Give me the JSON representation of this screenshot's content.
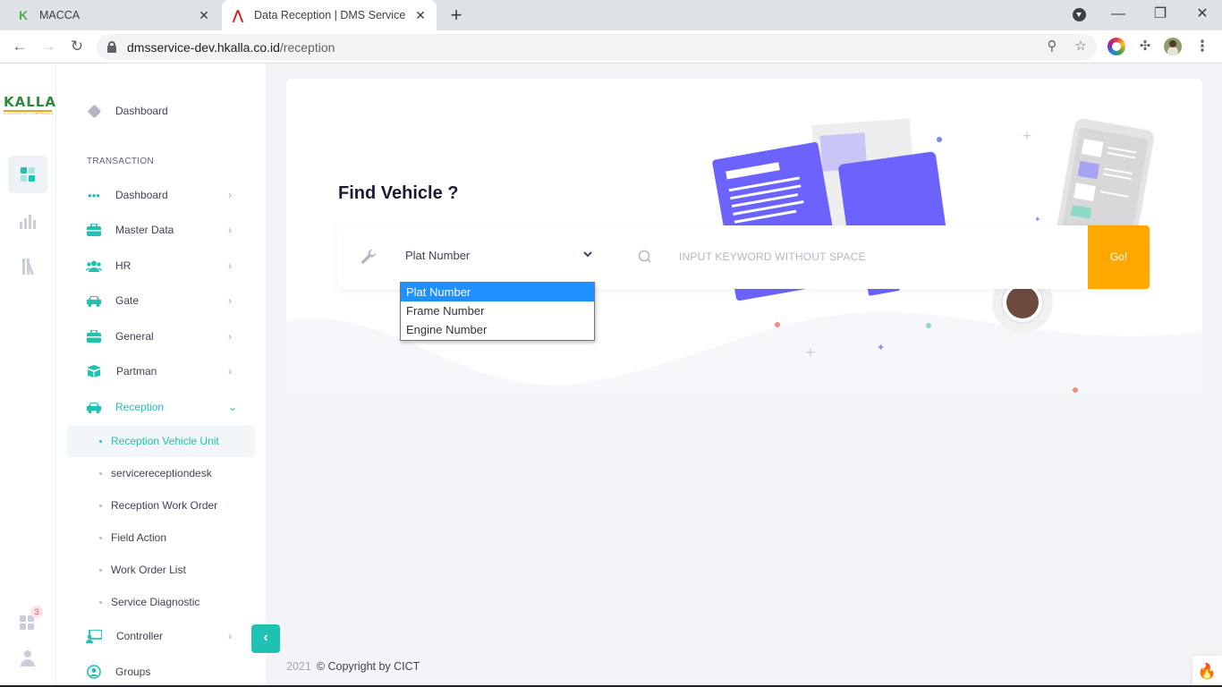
{
  "browser": {
    "tabs": [
      {
        "title": "MACCA",
        "favicon": "k-logo-icon",
        "active": false
      },
      {
        "title": "Data Reception | DMS Service",
        "favicon": "a-logo-icon",
        "active": true
      }
    ],
    "new_tab_glyph": "+",
    "close_glyph": "✕",
    "url_host": "dmsservice-dev.hkalla.co.id",
    "url_path": "/reception"
  },
  "rail": {
    "logo_text": "KALLA",
    "logo_sub": "A GROUP OF COMPANIES",
    "notification_count": "3"
  },
  "sidebar": {
    "top_item": "Dashboard",
    "section_title": "TRANSACTION",
    "items": [
      {
        "label": "Dashboard",
        "icon": "dots-icon"
      },
      {
        "label": "Master Data",
        "icon": "briefcase-icon"
      },
      {
        "label": "HR",
        "icon": "users-icon"
      },
      {
        "label": "Gate",
        "icon": "car-icon"
      },
      {
        "label": "General",
        "icon": "toolbox-icon"
      },
      {
        "label": "Partman",
        "icon": "box-icon"
      },
      {
        "label": "Reception",
        "icon": "car-icon"
      }
    ],
    "sub_items": [
      {
        "label": "Reception Vehicle Unit",
        "active": true
      },
      {
        "label": "servicereceptiondesk",
        "active": false
      },
      {
        "label": "Reception Work Order",
        "active": false
      },
      {
        "label": "Field Action",
        "active": false
      },
      {
        "label": "Work Order List",
        "active": false
      },
      {
        "label": "Service Diagnostic",
        "active": false
      }
    ],
    "after_items": [
      {
        "label": "Controller",
        "icon": "chalkboard-icon"
      },
      {
        "label": "Groups",
        "icon": "user-circle-icon"
      }
    ]
  },
  "main": {
    "title": "Find Vehicle ?",
    "search": {
      "selected_type": "Plat Number",
      "options": [
        "Plat Number",
        "Frame Number",
        "Engine Number"
      ],
      "placeholder": "INPUT KEYWORD WITHOUT SPACE",
      "value": "",
      "go_label": "Go!"
    }
  },
  "footer": {
    "year": "2021",
    "copyright": "© Copyright by CICT"
  },
  "colors": {
    "accent": "#1fc2b1",
    "go_button": "#ffa800",
    "illustration_purple": "#6c63ff",
    "dropdown_selected": "#1e90ff"
  }
}
